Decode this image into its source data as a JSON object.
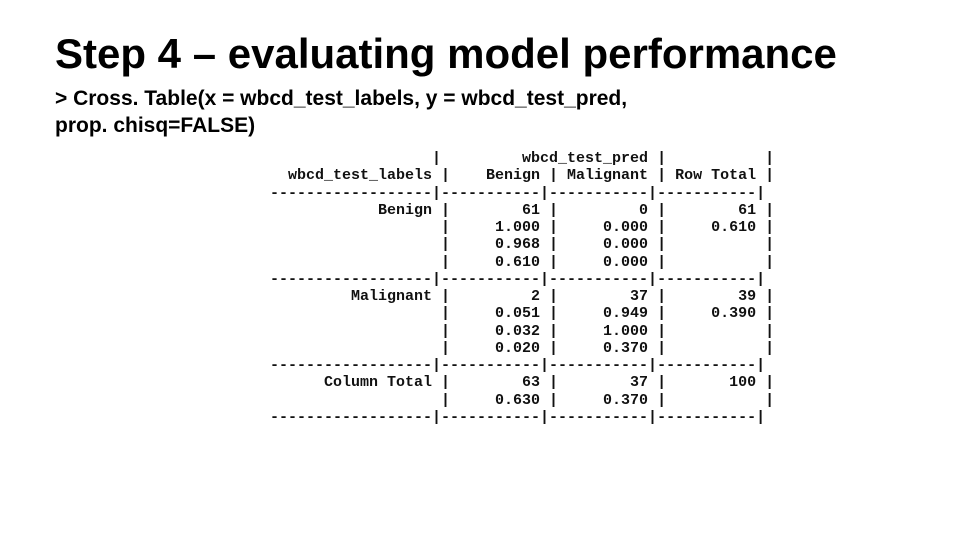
{
  "title": "Step 4 – evaluating model performance",
  "code_line1": "> Cross. Table(x = wbcd_test_labels, y = wbcd_test_pred,",
  "code_line2": "prop. chisq=FALSE)",
  "chart_data": {
    "type": "table",
    "title": "CrossTable",
    "row_var": "wbcd_test_labels",
    "col_var": "wbcd_test_pred",
    "col_categories": [
      "Benign",
      "Malignant"
    ],
    "row_categories": [
      "Benign",
      "Malignant"
    ],
    "cells": [
      {
        "row": "Benign",
        "col": "Benign",
        "count": 61,
        "row_pct": 1.0,
        "col_pct": 0.968,
        "tbl_pct": 0.61
      },
      {
        "row": "Benign",
        "col": "Malignant",
        "count": 0,
        "row_pct": 0.0,
        "col_pct": 0.0,
        "tbl_pct": 0.0
      },
      {
        "row": "Malignant",
        "col": "Benign",
        "count": 2,
        "row_pct": 0.051,
        "col_pct": 0.032,
        "tbl_pct": 0.02
      },
      {
        "row": "Malignant",
        "col": "Malignant",
        "count": 37,
        "row_pct": 0.949,
        "col_pct": 1.0,
        "tbl_pct": 0.37
      }
    ],
    "row_totals": [
      {
        "row": "Benign",
        "count": 61,
        "tbl_pct": 0.61
      },
      {
        "row": "Malignant",
        "count": 39,
        "tbl_pct": 0.39
      }
    ],
    "col_totals": [
      {
        "col": "Benign",
        "count": 63,
        "tbl_pct": 0.63
      },
      {
        "col": "Malignant",
        "count": 37,
        "tbl_pct": 0.37
      }
    ],
    "grand_total": 100
  }
}
